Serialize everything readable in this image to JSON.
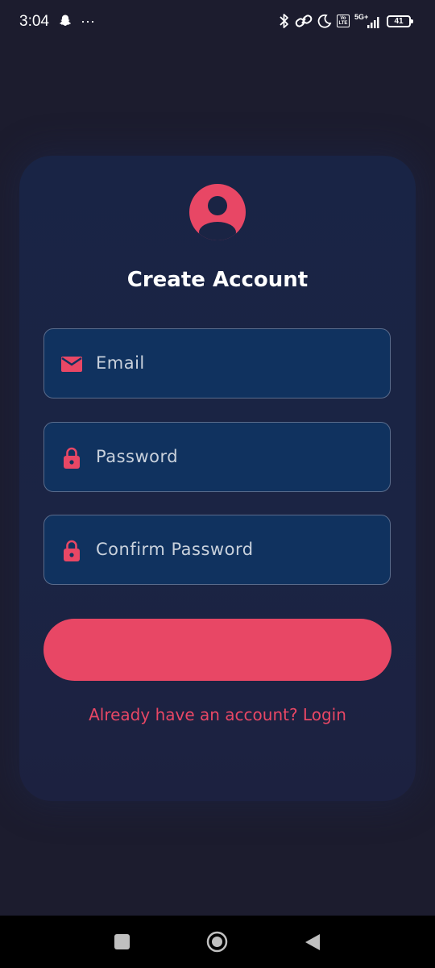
{
  "status_bar": {
    "time": "3:04",
    "more_dots": "···",
    "network_label": "5G+",
    "volte_label": "Vo LTE",
    "battery_level": "41"
  },
  "form": {
    "title": "Create Account",
    "email_placeholder": "Email",
    "password_placeholder": "Password",
    "confirm_password_placeholder": "Confirm Password",
    "submit_label": "",
    "login_link": "Already have an account? Login"
  },
  "colors": {
    "background": "#1c1c2e",
    "card": "#192445",
    "field_background": "#10325f",
    "accent": "#e84765",
    "text_primary": "#ffffff",
    "text_placeholder": "#c9d1dc"
  },
  "icons": {
    "avatar": "account-circle-icon",
    "email": "mail-icon",
    "password": "lock-icon",
    "confirm_password": "lock-icon",
    "nav_recents": "square-icon",
    "nav_home": "circle-icon",
    "nav_back": "triangle-back-icon"
  }
}
